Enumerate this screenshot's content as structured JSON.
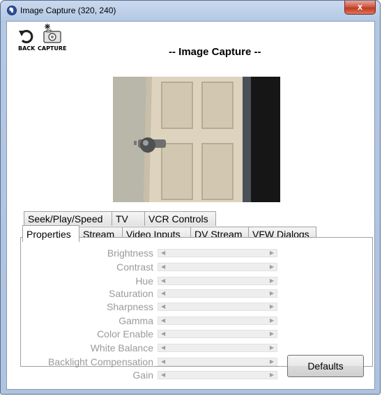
{
  "window": {
    "title": "Image Capture (320, 240)",
    "close_label": "x"
  },
  "toolbar": {
    "back_label": "BACK",
    "capture_label": "CAPTURE"
  },
  "heading": "-- Image Capture --",
  "tabs_row1": [
    "Seek/Play/Speed",
    "TV",
    "VCR Controls"
  ],
  "tabs_row2": [
    "Properties",
    "Stream",
    "Video Inputs",
    "DV Stream",
    "VFW Dialogs"
  ],
  "active_tab": "Properties",
  "properties": [
    {
      "label": "Brightness"
    },
    {
      "label": "Contrast"
    },
    {
      "label": "Hue"
    },
    {
      "label": "Saturation"
    },
    {
      "label": "Sharpness"
    },
    {
      "label": "Gamma"
    },
    {
      "label": "Color Enable"
    },
    {
      "label": "White Balance"
    },
    {
      "label": "Backlight Compensation"
    },
    {
      "label": "Gain"
    }
  ],
  "defaults_label": "Defaults",
  "colors": {
    "titlebar": "#b3c8e4",
    "close_button": "#c03a22",
    "disabled_text": "#9a9a9a"
  }
}
